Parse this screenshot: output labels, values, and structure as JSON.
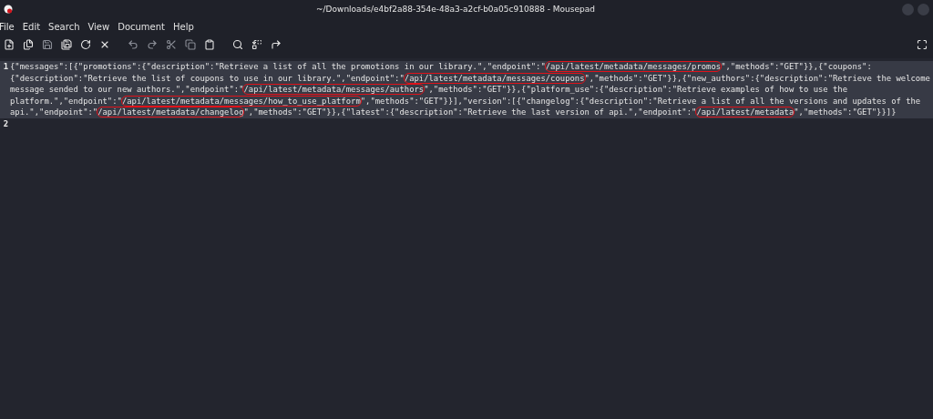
{
  "window": {
    "title": "~/Downloads/e4bf2a88-354e-48a3-a2cf-b0a05c910888 - Mousepad"
  },
  "menu": [
    "File",
    "Edit",
    "Search",
    "View",
    "Document",
    "Help"
  ],
  "editor": {
    "lines": [
      {
        "number": "1",
        "current": true,
        "rows": [
          [
            {
              "text": "{\"messages\":[{\"promotions\":{\"description\":\"Retrieve a list of all the promotions in our library.\",\"endpoint\":\"",
              "highlighted": false
            },
            {
              "text": "/api/latest/metadata/messages/promos",
              "highlighted": true
            },
            {
              "text": "\",\"methods\":\"GET\"}},{\"coupons\":",
              "highlighted": false
            }
          ],
          [
            {
              "text": "{\"description\":\"Retrieve the list of coupons to use in our library.\",\"endpoint\":\"",
              "highlighted": false
            },
            {
              "text": "/api/latest/metadata/messages/coupons",
              "highlighted": true
            },
            {
              "text": "\",\"methods\":\"GET\"}},{\"new_authors\":{\"description\":\"Retrieve the welcome",
              "highlighted": false
            }
          ],
          [
            {
              "text": "message sended to our new authors.\",\"endpoint\":\"",
              "highlighted": false
            },
            {
              "text": "/api/latest/metadata/messages/authors",
              "highlighted": true
            },
            {
              "text": "\",\"methods\":\"GET\"}},{\"platform_use\":{\"description\":\"Retrieve examples of how to use the",
              "highlighted": false
            }
          ],
          [
            {
              "text": "platform.\",\"endpoint\":\"",
              "highlighted": false
            },
            {
              "text": "/api/latest/metadata/messages/how_to_use_platform",
              "highlighted": true
            },
            {
              "text": "\",\"methods\":\"GET\"}}],\"version\":[{\"changelog\":{\"description\":\"Retrieve a list of all the versions and updates of the",
              "highlighted": false
            }
          ],
          [
            {
              "text": "api.\",\"endpoint\":\"",
              "highlighted": false
            },
            {
              "text": "/api/latest/metadata/changelog",
              "highlighted": true
            },
            {
              "text": "\",\"methods\":\"GET\"}},{\"latest\":{\"description\":\"Retrieve the last version of api.\",\"endpoint\":\"",
              "highlighted": false
            },
            {
              "text": "/api/latest/metadata",
              "highlighted": true
            },
            {
              "text": "\",\"methods\":\"GET\"}}]}",
              "highlighted": false
            }
          ]
        ]
      },
      {
        "number": "2",
        "current": false
      }
    ]
  }
}
